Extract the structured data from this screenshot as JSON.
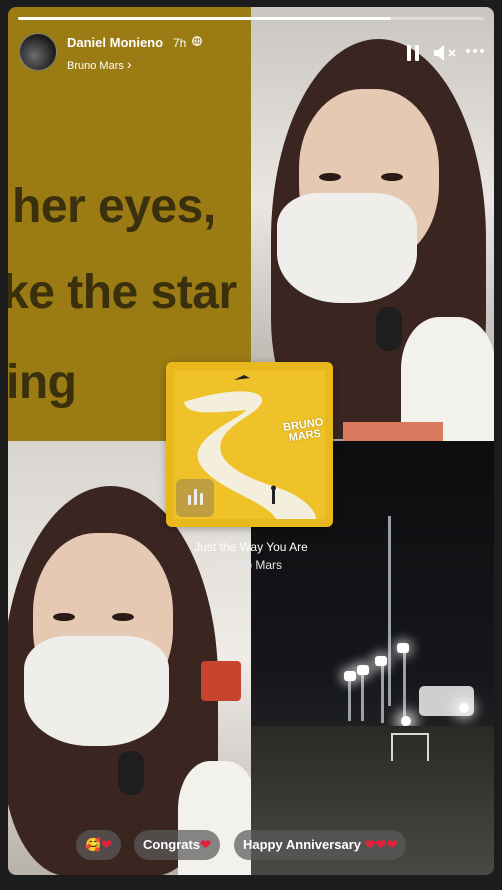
{
  "story": {
    "progress_fraction": 0.8,
    "user_name": "Daniel Monieno",
    "time_ago": "7h",
    "song_link": "Bruno Mars",
    "song_link_chevron": "›"
  },
  "lyrics": [
    "her eyes,",
    "ke the star",
    "ing"
  ],
  "album_art": {
    "band_text_1": "BRUNO",
    "band_text_2": "MARS"
  },
  "track": {
    "title": "Just the Way You Are",
    "artist": "Bruno Mars"
  },
  "reactions": [
    {
      "emoji": "🥰",
      "text": ""
    },
    {
      "emoji": "",
      "text": "Congrats"
    },
    {
      "emoji": "",
      "text": "Happy Anniversary"
    }
  ],
  "icons": {
    "pause": "pause-icon",
    "mute": "muted-speaker-icon",
    "more": "more-dots-icon",
    "globe": "globe-icon"
  },
  "colors": {
    "lyric_bg": "#9b7b14",
    "album_yellow": "#e9b81c",
    "heart": "#e2223b"
  }
}
